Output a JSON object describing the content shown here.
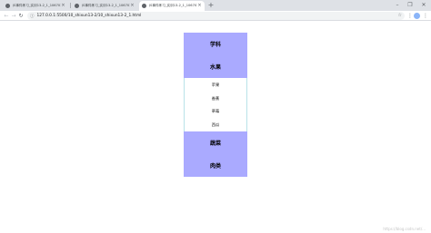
{
  "browser": {
    "tabs": [
      {
        "title": "JS事件练习_实训13-2_1_10670113...",
        "active": false
      },
      {
        "title": "JS事件练习_实训13-2_1_10670113...",
        "active": false
      },
      {
        "title": "JS事件练习_实训13-2_1_10670113...",
        "active": true
      }
    ],
    "new_tab_symbol": "+",
    "url": "127.0.0.1:5500/10_shixun13-2/10_shixun13-2_1.html",
    "controls": {
      "minimize": "–",
      "maximize": "❐",
      "close": "✕"
    }
  },
  "menu": {
    "items": [
      {
        "label": "学科",
        "children": []
      },
      {
        "label": "水果",
        "children": [
          "苹果",
          "香蕉",
          "草莓",
          "西瓜"
        ]
      },
      {
        "label": "蔬菜",
        "children": []
      },
      {
        "label": "肉类",
        "children": []
      }
    ]
  },
  "colors": {
    "menu_bg": "#aaaaff",
    "submenu_border": "#b9e3e8"
  },
  "watermark": "https://blog.csdn.net/..."
}
